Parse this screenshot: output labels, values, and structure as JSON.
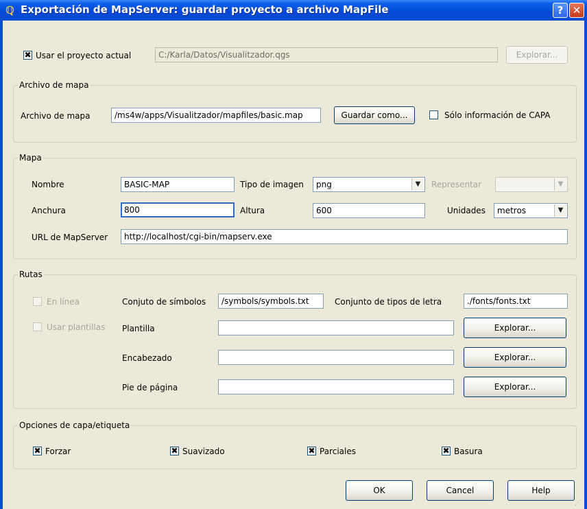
{
  "window": {
    "title": "Exportación de MapServer: guardar proyecto a archivo MapFile",
    "help_glyph": "?",
    "close_glyph": "✕",
    "app_icon_glyph": "ℚ"
  },
  "project": {
    "use_current_label": "Usar el proyecto actual",
    "use_current_checked": true,
    "path": "C:/Karla/Datos/Visualitzador.qgs",
    "browse_label": "Explorar..."
  },
  "mapfile": {
    "group_title": "Archivo de mapa",
    "label": "Archivo de mapa",
    "value": "/ms4w/apps/Visualitzador/mapfiles/basic.map",
    "save_as_label": "Guardar como...",
    "only_layer_label": "Sólo información de CAPA",
    "only_layer_checked": false
  },
  "map": {
    "group_title": "Mapa",
    "name_label": "Nombre",
    "name_value": "BASIC-MAP",
    "image_type_label": "Tipo de imagen",
    "image_type_value": "png",
    "render_label": "Representar",
    "render_value": "",
    "width_label": "Anchura",
    "width_value": "800",
    "height_label": "Altura",
    "height_value": "600",
    "units_label": "Unidades",
    "units_value": "metros",
    "url_label": "URL de MapServer",
    "url_value": "http://localhost/cgi-bin/mapserv.exe"
  },
  "paths": {
    "group_title": "Rutas",
    "online_label": "En línea",
    "online_checked": false,
    "use_templates_label": "Usar plantillas",
    "use_templates_checked": false,
    "symbols_label": "Conjuto de símbolos",
    "symbols_value": "/symbols/symbols.txt",
    "fonts_label": "Conjunto de tipos de letra",
    "fonts_value": "./fonts/fonts.txt",
    "template_label": "Plantilla",
    "template_value": "",
    "header_label": "Encabezado",
    "header_value": "",
    "footer_label": "Pie de página",
    "footer_value": "",
    "browse_label": "Explorar..."
  },
  "options": {
    "group_title": "Opciones de capa/etiqueta",
    "force_label": "Forzar",
    "force_checked": true,
    "antialias_label": "Suavizado",
    "antialias_checked": true,
    "partials_label": "Parciales",
    "partials_checked": true,
    "trash_label": "Basura",
    "trash_checked": true
  },
  "buttons": {
    "ok": "OK",
    "cancel": "Cancel",
    "help": "Help"
  },
  "icons": {
    "check_mark": "✖",
    "dropdown": "▼",
    "resize_grip": "⋰"
  },
  "colors": {
    "titlebar": "#0a5ee8",
    "dialog_bg": "#ece9d8",
    "close": "#c6391c"
  }
}
